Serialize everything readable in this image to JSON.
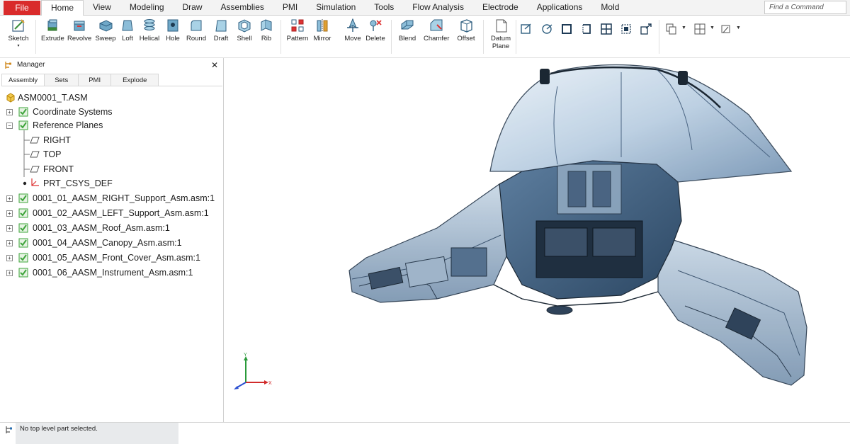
{
  "menu": {
    "file": "File",
    "tabs": [
      "Home",
      "View",
      "Modeling",
      "Draw",
      "Assemblies",
      "PMI",
      "Simulation",
      "Tools",
      "Flow Analysis",
      "Electrode",
      "Applications",
      "Mold"
    ],
    "active_tab": "Home",
    "search_placeholder": "Find a Command"
  },
  "ribbon": {
    "sketch": "Sketch",
    "extrude": "Extrude",
    "revolve": "Revolve",
    "sweep": "Sweep",
    "loft": "Loft",
    "helical": "Helical",
    "hole": "Hole",
    "round": "Round",
    "draft": "Draft",
    "shell": "Shell",
    "rib": "Rib",
    "pattern": "Pattern",
    "mirror": "Mirror",
    "move": "Move",
    "delete": "Delete",
    "blend": "Blend",
    "chamfer": "Chamfer",
    "offset": "Offset",
    "datum_plane_1": "Datum",
    "datum_plane_2": "Plane"
  },
  "manager": {
    "title": "Manager",
    "close": "✕",
    "tabs": [
      "Assembly",
      "Sets",
      "PMI",
      "Explode"
    ],
    "active_tab": "Assembly",
    "root": "ASM0001_T.ASM",
    "nodes": [
      "Coordinate Systems",
      "Reference Planes",
      "RIGHT",
      "TOP",
      "FRONT",
      "PRT_CSYS_DEF",
      "0001_01_AASM_RIGHT_Support_Asm.asm:1",
      "0001_02_AASM_LEFT_Support_Asm.asm:1",
      "0001_03_AASM_Roof_Asm.asm:1",
      "0001_04_AASM_Canopy_Asm.asm:1",
      "0001_05_AASM_Front_Cover_Asm.asm:1",
      "0001_06_AASM_Instrument_Asm.asm:1"
    ]
  },
  "status": {
    "message": "No top level part selected."
  },
  "triad": {
    "y": "Y",
    "x": "X"
  },
  "colors": {
    "file_button": "#d92b2b",
    "check_green": "#3ea43b",
    "model_blue": "#4d6f93",
    "axis_x": "#d12b2b",
    "axis_y": "#2a9a3a",
    "axis_z": "#2a4fd1"
  }
}
